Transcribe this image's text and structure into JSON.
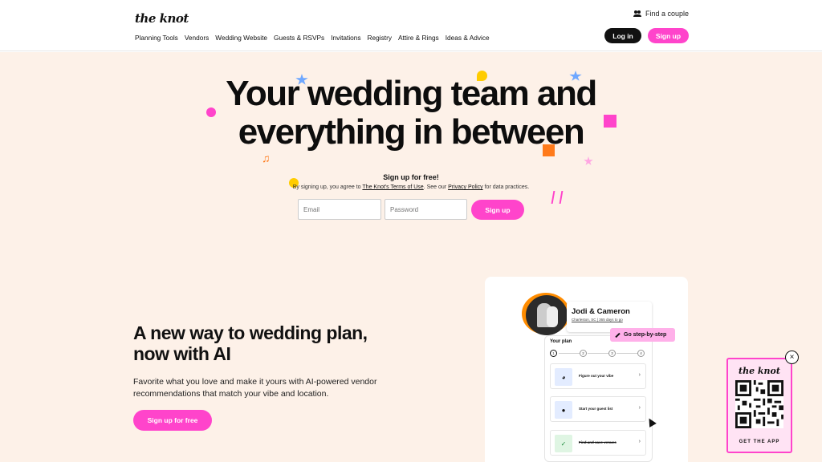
{
  "header": {
    "logo": "the knot",
    "find_couple": "Find a couple",
    "nav": [
      "Planning Tools",
      "Vendors",
      "Wedding Website",
      "Guests & RSVPs",
      "Invitations",
      "Registry",
      "Attire & Rings",
      "Ideas & Advice"
    ],
    "login_label": "Log in",
    "signup_label": "Sign up"
  },
  "hero": {
    "title_line1": "Your wedding team and",
    "title_line2": "everything in between",
    "signup_title": "Sign up for free!",
    "terms_prefix": "By signing up, you agree to",
    "terms_link": "The Knot's Terms of Use",
    "terms_mid": ". See our",
    "privacy_link": "Privacy Policy",
    "terms_suffix": "for data practices.",
    "email_placeholder": "Email",
    "password_placeholder": "Password",
    "signup_button": "Sign up"
  },
  "section_ai": {
    "title": "A new way to wedding plan, now with AI",
    "body": "Favorite what you love and make it yours with AI-powered vendor recommendations that match your vibe and location.",
    "cta": "Sign up for free"
  },
  "plan_card": {
    "couple_name": "Jodi & Cameron",
    "couple_meta": "Charleston, SC  |  365 days to go",
    "step_button": "Go step-by-step",
    "plan_label": "Your plan",
    "steps": [
      "1",
      "2",
      "3",
      "4"
    ],
    "tasks": [
      {
        "label": "Figure out your vibe",
        "icon": "palette-icon"
      },
      {
        "label": "Start your guest list",
        "icon": "guests-icon"
      },
      {
        "label": "Find and save venues",
        "icon": "check-icon"
      }
    ]
  },
  "qr_widget": {
    "logo": "the knot",
    "cta": "GET THE APP"
  },
  "colors": {
    "brand_pink": "#ff44cb",
    "hero_bg": "#fdf1e8",
    "dark": "#111111"
  }
}
